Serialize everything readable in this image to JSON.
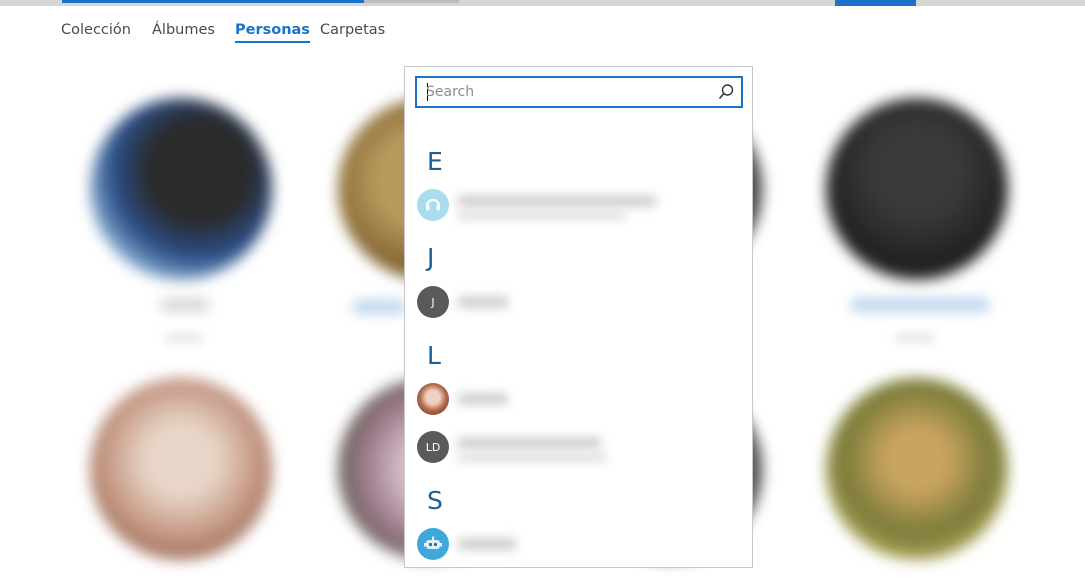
{
  "tabs": [
    {
      "label": "Colección",
      "active": false
    },
    {
      "label": "Álbumes",
      "active": false
    },
    {
      "label": "Personas",
      "active": true
    },
    {
      "label": "Carpetas",
      "active": false
    }
  ],
  "search": {
    "placeholder": "Search",
    "value": ""
  },
  "groups": [
    {
      "letter": "E",
      "contacts": [
        {
          "initials": "",
          "avatar": "headset-avatar-icon"
        }
      ]
    },
    {
      "letter": "J",
      "contacts": [
        {
          "initials": "J",
          "avatar": "initial-avatar"
        }
      ]
    },
    {
      "letter": "L",
      "contacts": [
        {
          "initials": "",
          "avatar": "photo-avatar"
        },
        {
          "initials": "LD",
          "avatar": "initial-avatar"
        }
      ]
    },
    {
      "letter": "S",
      "contacts": [
        {
          "initials": "",
          "avatar": "robot-avatar-icon"
        }
      ]
    }
  ],
  "colors": {
    "accent": "#1a73c8",
    "letter": "#1a5f95",
    "initial_avatar": "#5a5a5a",
    "headset_avatar": "#a9dcec",
    "robot_avatar": "#3ea8d8"
  }
}
